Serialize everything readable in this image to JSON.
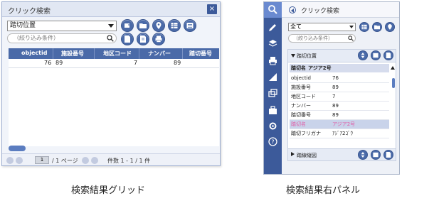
{
  "grid_panel": {
    "title": "クリック検索",
    "close_label": "×",
    "layer_select": "踏切位置",
    "search_placeholder": "（絞り込み条件）",
    "columns": [
      "objectid",
      "施設番号",
      "地区コード",
      "ナンバー",
      "踏切番号"
    ],
    "rows": [
      [
        "76",
        "89",
        "7",
        "89",
        ""
      ]
    ],
    "pager": {
      "page": "1",
      "total": "/ 1 ページ",
      "count": "件数 1 - 1 / 1 件"
    },
    "caption": "検索結果グリッド"
  },
  "right_panel": {
    "title": "クリック検索",
    "layer_select": "全て",
    "search_placeholder": "（絞り込み条件）",
    "section1": {
      "title": "踏切位置",
      "header_name": "踏切名",
      "header_value": "アジア2号",
      "rows": [
        {
          "key": "objectid",
          "value": "76"
        },
        {
          "key": "施設番号",
          "value": "89"
        },
        {
          "key": "地区コード",
          "value": "7"
        },
        {
          "key": "ナンバー",
          "value": "89"
        },
        {
          "key": "踏切番号",
          "value": "89"
        },
        {
          "key": "踏切名",
          "value": "アジア2号"
        },
        {
          "key": "踏切フリガナ",
          "value": "ｱｼﾞｱ2ｺﾞｳ"
        }
      ]
    },
    "section2": {
      "title": "踏線縦図"
    },
    "caption": "検索結果右パネル"
  },
  "colors": {
    "accent": "#4a6aa8",
    "sidebar": "#3c5a9a",
    "highlight_text": "#e060a8"
  },
  "icons": {
    "sidebar": [
      "search-icon",
      "pencil-icon",
      "layers-icon",
      "print-icon",
      "measure-icon",
      "windows-icon",
      "toolbox-icon",
      "gear-icon",
      "help-icon"
    ],
    "toolbar": [
      "export-icon",
      "folder-icon",
      "pin-icon",
      "table-icon",
      "list-icon",
      "doc-icon",
      "doc2-icon",
      "print-icon"
    ]
  }
}
